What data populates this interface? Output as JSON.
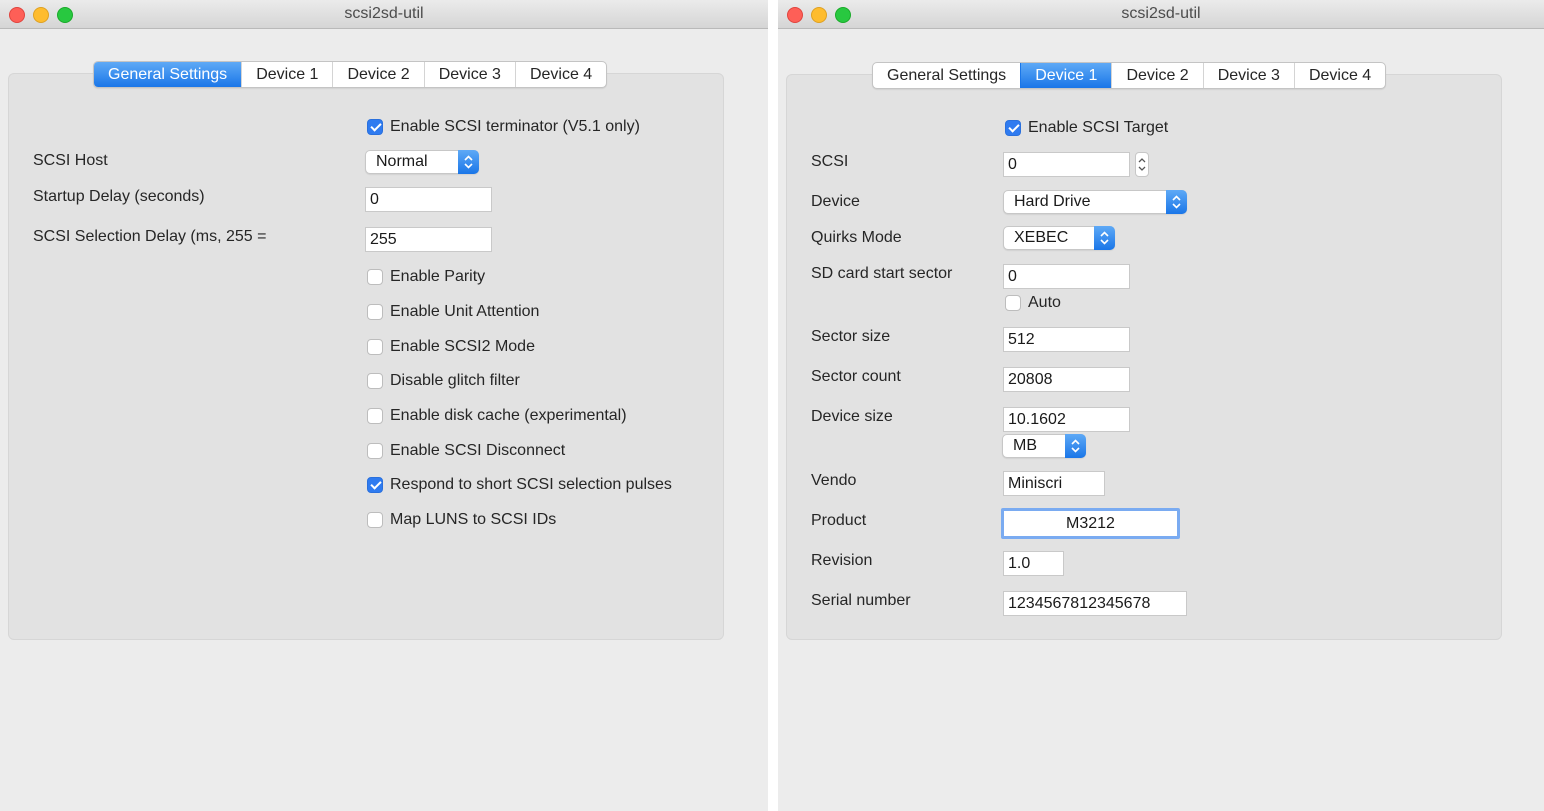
{
  "left_window": {
    "title": "scsi2sd-util",
    "tabs": [
      "General Settings",
      "Device 1",
      "Device 2",
      "Device 3",
      "Device 4"
    ],
    "active_tab": "General Settings",
    "terminator_label": "Enable SCSI terminator (V5.1 only)",
    "terminator_checked": true,
    "scsi_host_label": "SCSI Host",
    "scsi_host_value": "Normal",
    "startup_delay_label": "Startup Delay (seconds)",
    "startup_delay_value": "0",
    "selection_delay_label": "SCSI Selection Delay (ms, 255 =",
    "selection_delay_value": "255",
    "options": [
      {
        "label": "Enable Parity",
        "checked": false
      },
      {
        "label": "Enable Unit Attention",
        "checked": false
      },
      {
        "label": "Enable SCSI2 Mode",
        "checked": false
      },
      {
        "label": "Disable glitch filter",
        "checked": false
      },
      {
        "label": "Enable disk cache (experimental)",
        "checked": false
      },
      {
        "label": "Enable SCSI Disconnect",
        "checked": false
      },
      {
        "label": "Respond to short SCSI selection pulses",
        "checked": true
      },
      {
        "label": "Map LUNS to SCSI IDs",
        "checked": false
      }
    ]
  },
  "right_window": {
    "title": "scsi2sd-util",
    "tabs": [
      "General Settings",
      "Device 1",
      "Device 2",
      "Device 3",
      "Device 4"
    ],
    "active_tab": "Device 1",
    "enable_target_label": "Enable SCSI Target",
    "enable_target_checked": true,
    "scsi_label": "SCSI",
    "scsi_value": "0",
    "device_label": "Device",
    "device_value": "Hard Drive",
    "quirks_label": "Quirks Mode",
    "quirks_value": "XEBEC",
    "sd_start_label": "SD card start sector",
    "sd_start_value": "0",
    "auto_label": "Auto",
    "auto_checked": false,
    "sector_size_label": "Sector size",
    "sector_size_value": "512",
    "sector_count_label": "Sector count",
    "sector_count_value": "20808",
    "device_size_label": "Device size",
    "device_size_value": "10.1602",
    "device_size_unit": "MB",
    "vendor_label": "Vendo",
    "vendor_value": "Miniscri",
    "product_label": "Product",
    "product_value": "M3212",
    "revision_label": "Revision",
    "revision_value": "1.0",
    "serial_label": "Serial number",
    "serial_value": "1234567812345678"
  },
  "colors": {
    "accent": "#1a76e8",
    "window_bg": "#ececec",
    "panel_bg": "#e2e2e2",
    "close": "#fe5f57",
    "minimize": "#febc2e",
    "maximize": "#28c840"
  }
}
